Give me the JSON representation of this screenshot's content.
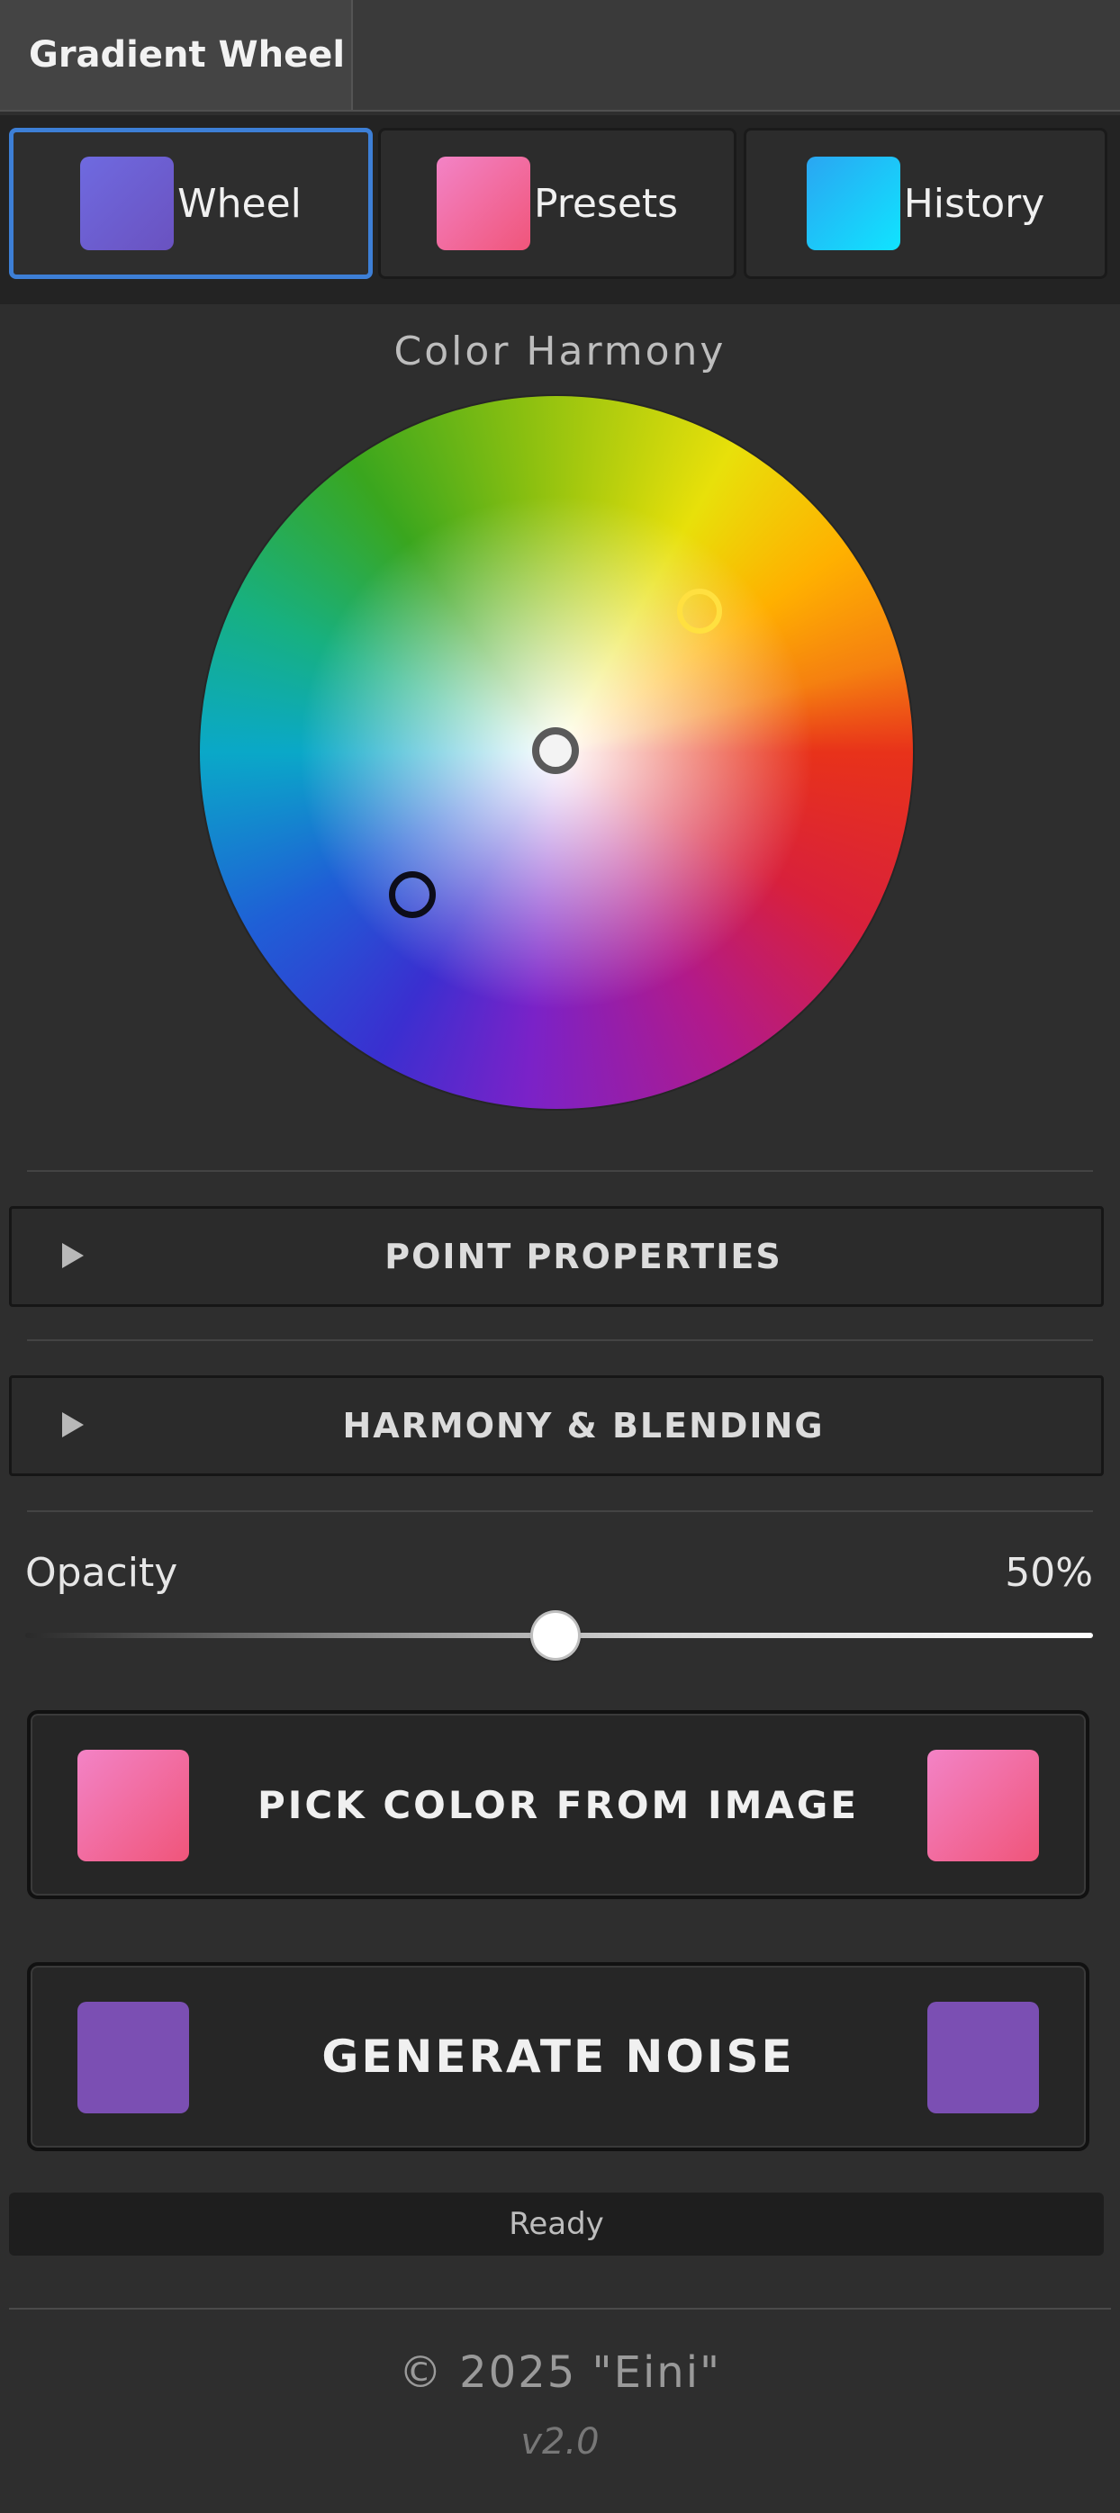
{
  "window": {
    "title": "Gradient Wheel"
  },
  "tabs": [
    {
      "label": "Wheel",
      "swatch_color": "#6a62d8",
      "active": true
    },
    {
      "label": "Presets",
      "swatch_color": "#f062a0",
      "active": false
    },
    {
      "label": "History",
      "swatch_color": "#16c6f2",
      "active": false
    }
  ],
  "wheel": {
    "heading": "Color Harmony",
    "markers": [
      {
        "name": "yellow-point",
        "color": "#ffe040"
      },
      {
        "name": "center-point",
        "color": "#555555"
      },
      {
        "name": "blue-point",
        "color": "#0d0d1a"
      }
    ]
  },
  "sections": {
    "point_properties": "POINT PROPERTIES",
    "harmony_blending": "HARMONY & BLENDING"
  },
  "opacity": {
    "label": "Opacity",
    "value_text": "50%",
    "value": 0.5
  },
  "actions": {
    "pick_color": {
      "label": "PICK COLOR FROM IMAGE",
      "swatch_color": "#f0608c"
    },
    "generate_noise": {
      "label": "GENERATE NOISE",
      "swatch_color": "#7b4fb3"
    }
  },
  "status": {
    "text": "Ready"
  },
  "footer": {
    "copyright": "© 2025 \"Eini\"",
    "version": "v2.0"
  },
  "colors": {
    "accent": "#3d7fd6",
    "background": "#2e2e2e"
  }
}
